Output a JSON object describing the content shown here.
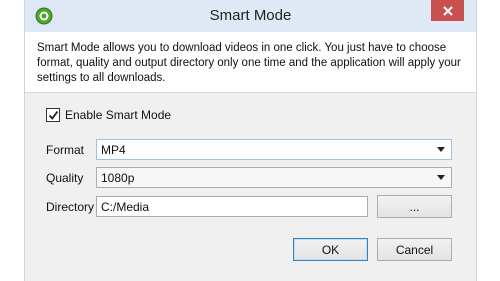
{
  "window": {
    "title": "Smart Mode",
    "description": "Smart Mode allows you to download videos in one click. You just have to choose format, quality and output directory only one time and the application will apply your settings to all downloads."
  },
  "smart_mode": {
    "label": "Enable Smart Mode",
    "checked": true
  },
  "format": {
    "label": "Format",
    "value": "MP4"
  },
  "quality": {
    "label": "Quality",
    "value": "1080p"
  },
  "directory": {
    "label": "Directory",
    "value": "C:/Media",
    "browse_label": "..."
  },
  "buttons": {
    "ok": "OK",
    "cancel": "Cancel"
  },
  "colors": {
    "close_button": "#c75050",
    "titlebar": "#dfe9f5",
    "focus_border": "#9cc4e8"
  },
  "icons": {
    "app": "green-app-icon",
    "close": "close-icon",
    "check": "checkmark-icon",
    "dropdown": "chevron-down-icon"
  }
}
